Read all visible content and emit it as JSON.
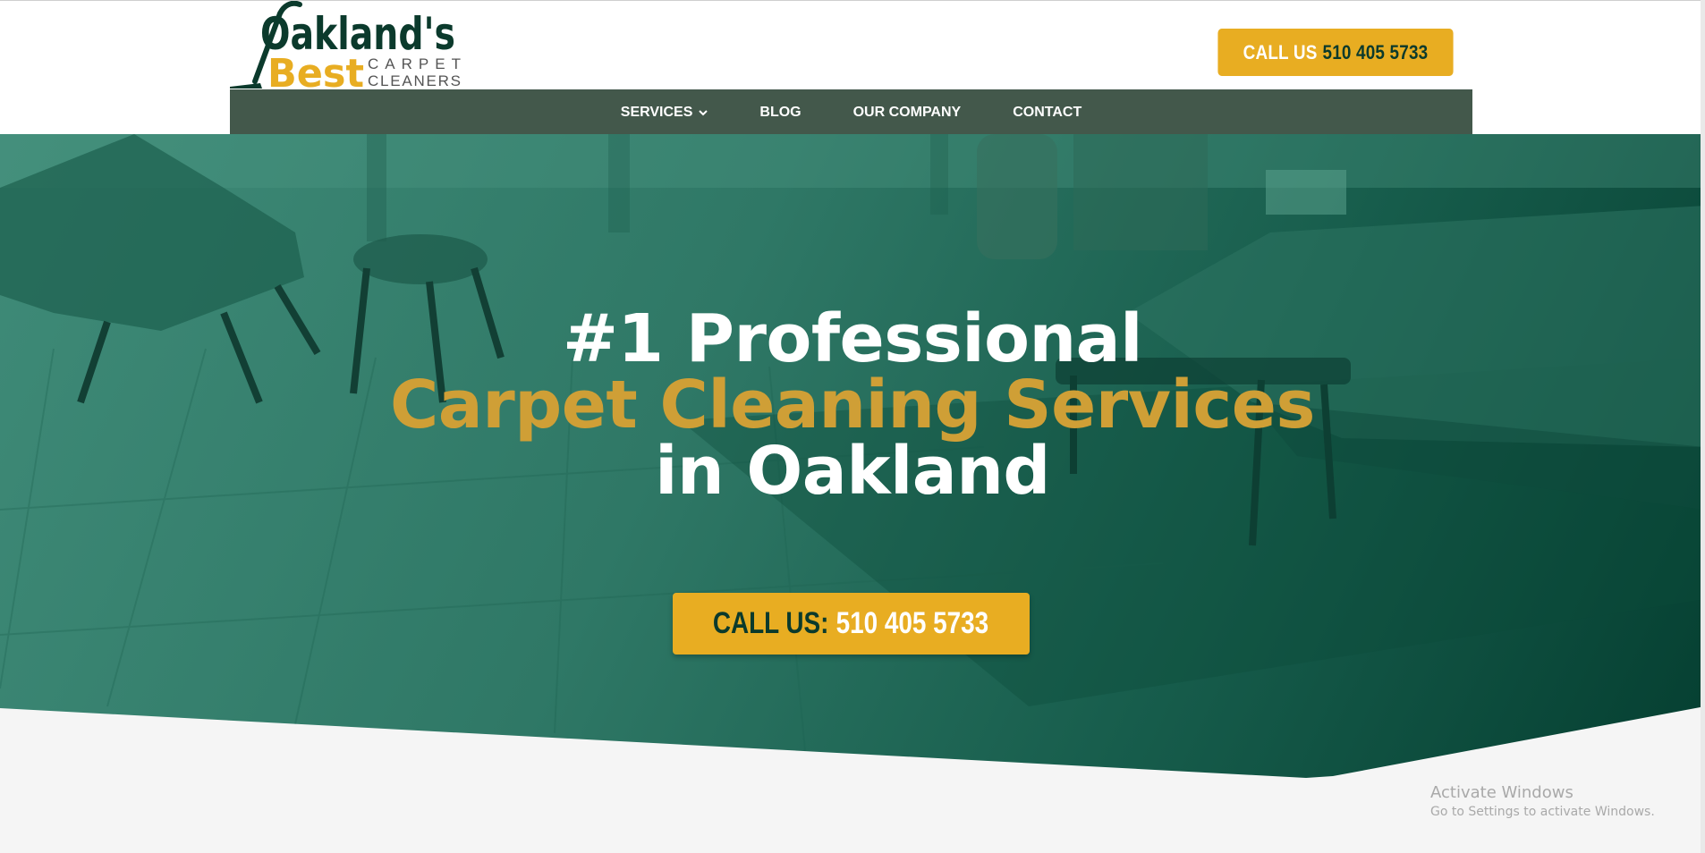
{
  "header": {
    "logo": {
      "line1": "Oakland's",
      "line2": "Best",
      "tag1": "CARPET",
      "tag2": "CLEANERS"
    },
    "cta": {
      "label": "CALL US",
      "phone": "510 405 5733"
    }
  },
  "nav": {
    "items": [
      {
        "label": "SERVICES",
        "has_dropdown": true
      },
      {
        "label": "BLOG"
      },
      {
        "label": "OUR COMPANY"
      },
      {
        "label": "CONTACT"
      }
    ]
  },
  "hero": {
    "line1": "#1 Professional",
    "line2": "Carpet Cleaning Services",
    "line3": "in Oakland",
    "cta": {
      "label": "CALL US:",
      "phone": "510 405 5733"
    }
  },
  "watermark": {
    "line1": "Activate Windows",
    "line2": "Go to Settings to activate Windows."
  },
  "colors": {
    "brand_green": "#0b3a2c",
    "nav_bg": "#43584b",
    "accent_yellow": "#e8ad22",
    "gold_text": "#cf9f36",
    "hero_teal": "#2f7866"
  }
}
